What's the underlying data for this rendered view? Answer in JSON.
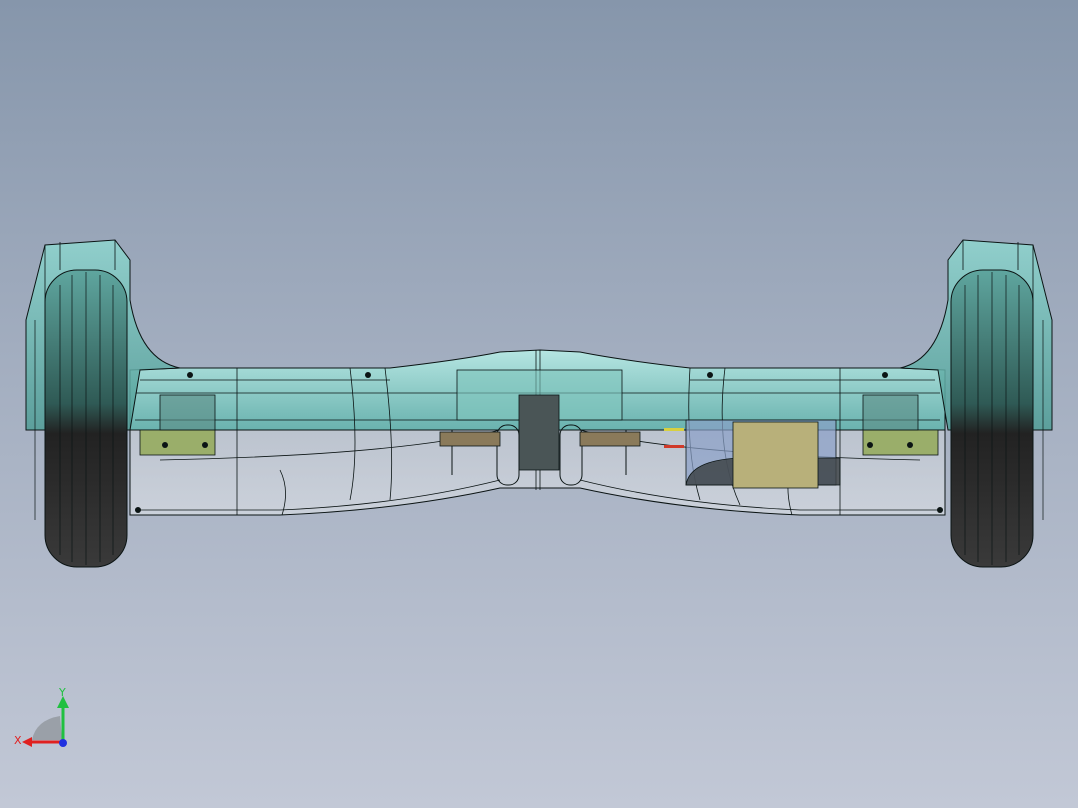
{
  "viewport": {
    "background_top": "#8696ab",
    "background_bottom": "#c2c8d6"
  },
  "model": {
    "subject": "hoverboard-assembly",
    "shell_color": "#6fc6bf",
    "tire_color": "#1e2a28",
    "edge_color": "#0b1414",
    "component_colors": {
      "green_board": "#9aae6a",
      "tan_block": "#b8b07a",
      "blue_part": "#8aa0c8",
      "wire_red": "#d03a2a",
      "wire_yellow": "#d8d040"
    }
  },
  "triad": {
    "x_label": "X",
    "y_label": "Y",
    "x_color": "#e02020",
    "y_color": "#20c040",
    "z_color": "#2030e0"
  }
}
